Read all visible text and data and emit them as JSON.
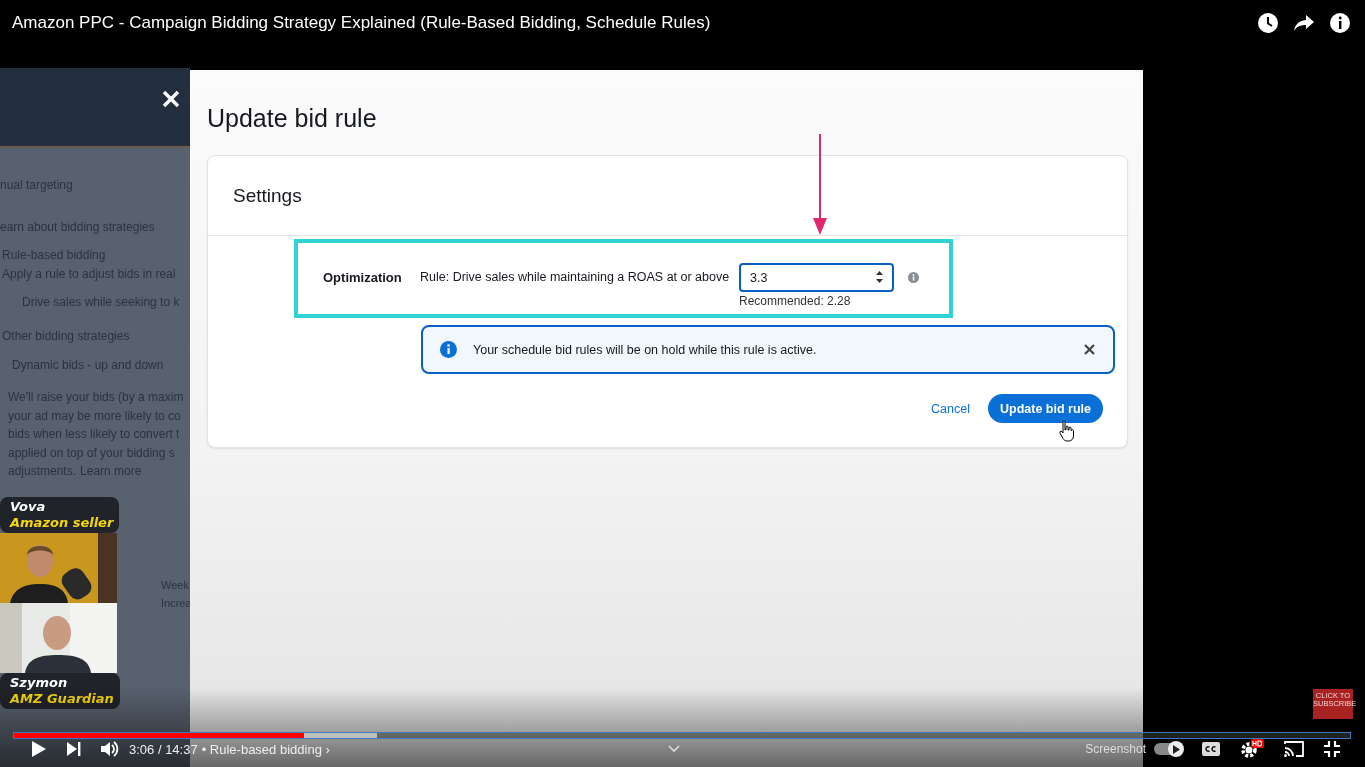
{
  "video_title": "Amazon PPC - Campaign Bidding Strategy Explained (Rule-Based Bidding, Schedule Rules)",
  "side_panel": {
    "lines": [
      {
        "text": "nual targeting",
        "kind": "link"
      },
      {
        "text": "earn about bidding strategies",
        "kind": "text"
      },
      {
        "text": "Rule-based bidding",
        "kind": "radio"
      },
      {
        "text": "Apply a rule to adjust bids in real",
        "kind": "text"
      },
      {
        "text": "Drive sales while seeking to k",
        "kind": "text"
      },
      {
        "text": "Other bidding strategies",
        "kind": "radio"
      },
      {
        "text": "Dynamic bids - up and down",
        "kind": "select"
      }
    ],
    "paragraph": [
      "We'll raise your bids (by a maxim",
      "your ad may be more likely to co",
      "bids when less likely to convert t",
      "applied on top of your bidding s"
    ],
    "paragraph_end": "adjustments.",
    "learn_more": "Learn more",
    "schedule_lines": [
      "Week",
      "Increa"
    ]
  },
  "page_title": "Update bid rule",
  "card": {
    "title": "Settings",
    "optimization": {
      "label": "Optimization",
      "rule": "Rule: Drive sales while maintaining a ROAS at or above",
      "value": "3.3",
      "recommended": "Recommended: 2.28"
    },
    "alert": "Your schedule bid rules will be on hold while this rule is active.",
    "buttons": [
      {
        "label": "Cancel",
        "kind": "link"
      },
      {
        "label": "Update bid rule",
        "kind": "primary"
      }
    ]
  },
  "participants": [
    {
      "name": "Vova",
      "role": "Amazon seller"
    },
    {
      "name": "Szymon",
      "role": "AMZ Guardian"
    }
  ],
  "subscribe_badge": "CLICK TO SUBSCRIBE",
  "player": {
    "progress": {
      "level": 0.217
    },
    "buffer": {
      "level": 0.272
    },
    "time": "3:06 / 14:37",
    "chapter": "• Rule-based bidding ›",
    "screenshot": {
      "label": "Screenshot",
      "on": true
    }
  }
}
